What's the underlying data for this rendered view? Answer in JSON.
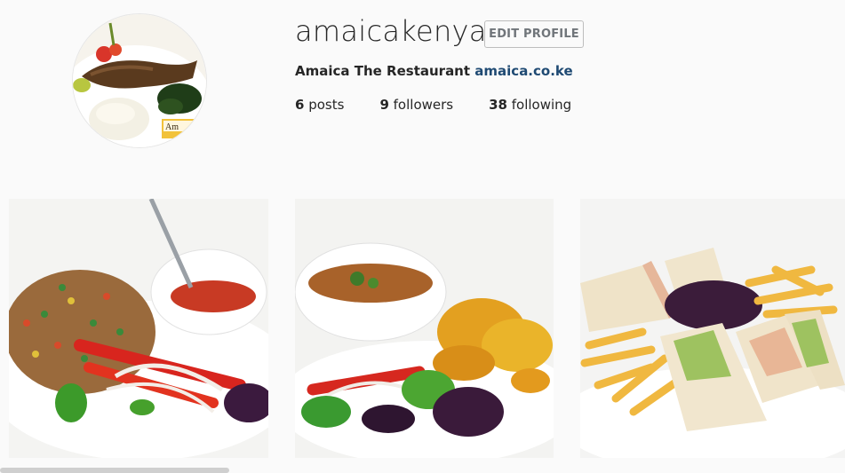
{
  "profile": {
    "username": "amaicakenya",
    "edit_button_label": "EDIT PROFILE",
    "full_name": "Amaica The Restaurant",
    "website": "amaica.co.ke",
    "stats": {
      "posts_count": "6",
      "posts_label": "posts",
      "followers_count": "9",
      "followers_label": "followers",
      "following_count": "38",
      "following_label": "following"
    },
    "avatar_badge_text": "Am"
  },
  "posts": [
    {
      "subject": "fried rice with salad and sauce"
    },
    {
      "subject": "stew with plantain and salad"
    },
    {
      "subject": "club sandwiches with fries"
    }
  ],
  "colors": {
    "link": "#1f4a73",
    "button_border": "#bdbdbd",
    "background": "#fafafa"
  }
}
